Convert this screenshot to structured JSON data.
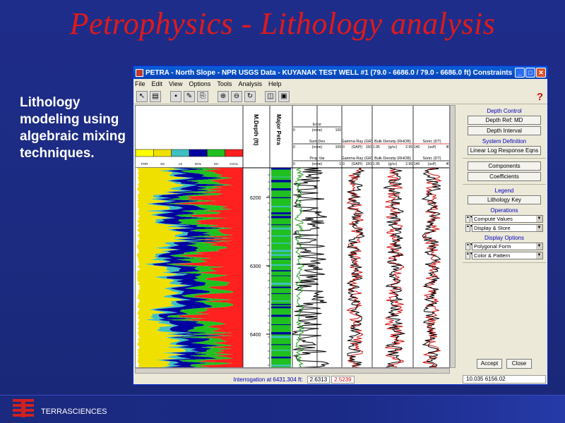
{
  "slide": {
    "title": "Petrophysics - Lithology analysis",
    "side_text": "Lithology modeling using algebraic mixing techniques.",
    "footer_company": "TERRASCIENCES"
  },
  "window": {
    "title": "PETRA - North Slope - NPR USGS Data - KUYANAK TEST WELL #1 (79.0 - 6686.0 / 79.0 - 6686.0 ft) Constraints:  None",
    "menu": [
      "File",
      "Edit",
      "View",
      "Options",
      "Tools",
      "Analysis",
      "Help"
    ]
  },
  "lith_legend": [
    "POR",
    "SS",
    "LS",
    "DOL",
    "SH",
    "COAL"
  ],
  "colors": {
    "por": "#ffff00",
    "ss": "#f0e000",
    "ls": "#40c0c0",
    "dol": "#0000a0",
    "sh": "#20c020",
    "coal": "#ff2020"
  },
  "tracks": {
    "depth_label": "M.Depth (ft)",
    "major_label": "Major Petra",
    "depth_ticks": [
      "6200",
      "6300",
      "6400"
    ],
    "error": {
      "name": "Error",
      "unit": "(none)",
      "min": "0",
      "max": "100"
    },
    "sumdev": {
      "name": "Sum Dev",
      "unit": "(none)",
      "min": "0",
      "max": "100"
    },
    "propvar": {
      "name": "Prop Var",
      "unit": "(none)",
      "min": "0",
      "max": "1"
    },
    "gr_top": {
      "name": "Gamma Ray (GR)",
      "unit": "(GAPI)",
      "min": "0",
      "max": "150"
    },
    "gr_bot": {
      "name": "Gamma Ray (GR)",
      "unit": "(GAPI)",
      "min": "0",
      "max": "150"
    },
    "rhob_top": {
      "name": "Bulk Density (RHOB)",
      "unit": "(g/cc)",
      "min": "1.95",
      "max": "2.95"
    },
    "rhob_bot": {
      "name": "Bulk Density (RHOB)",
      "unit": "(g/cc)",
      "min": "1.95",
      "max": "2.95"
    },
    "dt_top": {
      "name": "Sonic (DT)",
      "unit": "(us/f)",
      "min": "140",
      "max": "40"
    },
    "dt_bot": {
      "name": "Sonic (DT)",
      "unit": "(us/f)",
      "min": "140",
      "max": "40"
    }
  },
  "panel": {
    "depth_control": "Depth Control",
    "depth_ref": "Depth Ref:  MD",
    "depth_interval": "Depth Interval",
    "system_definition": "System Definition",
    "linear_log": "Linear Log Response Eqns",
    "components": "Components",
    "coefficients": "Coefficients",
    "legend": "Legend",
    "lithology_key": "Lithology Key",
    "operations": "Operations",
    "compute_values": "Compute Values",
    "display_store": "Display & Store",
    "display_options": "Display Options",
    "polygonal_form": "Polygonal Form",
    "color_pattern": "Color & Pattern",
    "accept": "Accept",
    "close": "Close"
  },
  "status": {
    "label": "Interrogation at 6431.304 ft:",
    "value1": "2.6313",
    "value2": "2.5239",
    "coords": "10.035  6156.02"
  }
}
